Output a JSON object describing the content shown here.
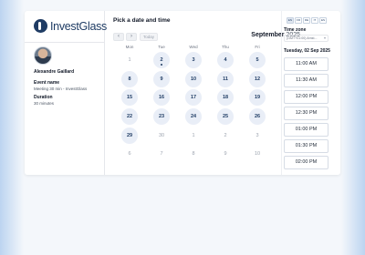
{
  "brand": {
    "name": "InvestGlass"
  },
  "host": {
    "name": "Alexandre Gaillard",
    "event_label": "Event name",
    "event_value": "Meeting 30 min - InvestGlass",
    "duration_label": "Duration",
    "duration_value": "30 minutes"
  },
  "calendar": {
    "title": "Pick a date and time",
    "prev_label": "‹",
    "next_label": "›",
    "today_label": "Today",
    "month": "September",
    "year": "2025",
    "weekdays": [
      "Mon",
      "Tue",
      "Wed",
      "Thu",
      "Fri"
    ],
    "weeks": [
      [
        {
          "d": "1",
          "a": false
        },
        {
          "d": "2",
          "a": true,
          "t": true
        },
        {
          "d": "3",
          "a": true
        },
        {
          "d": "4",
          "a": true
        },
        {
          "d": "5",
          "a": true
        }
      ],
      [
        {
          "d": "8",
          "a": true
        },
        {
          "d": "9",
          "a": true
        },
        {
          "d": "10",
          "a": true
        },
        {
          "d": "11",
          "a": true
        },
        {
          "d": "12",
          "a": true
        }
      ],
      [
        {
          "d": "15",
          "a": true
        },
        {
          "d": "16",
          "a": true
        },
        {
          "d": "17",
          "a": true
        },
        {
          "d": "18",
          "a": true
        },
        {
          "d": "19",
          "a": true
        }
      ],
      [
        {
          "d": "22",
          "a": true
        },
        {
          "d": "23",
          "a": true
        },
        {
          "d": "24",
          "a": true
        },
        {
          "d": "25",
          "a": true
        },
        {
          "d": "26",
          "a": true
        }
      ],
      [
        {
          "d": "29",
          "a": true
        },
        {
          "d": "30",
          "a": false
        },
        {
          "d": "1",
          "a": false
        },
        {
          "d": "2",
          "a": false
        },
        {
          "d": "3",
          "a": false
        }
      ],
      [
        {
          "d": "6",
          "a": false
        },
        {
          "d": "7",
          "a": false
        },
        {
          "d": "8",
          "a": false
        },
        {
          "d": "9",
          "a": false
        },
        {
          "d": "10",
          "a": false
        }
      ]
    ]
  },
  "sidebar": {
    "languages": [
      "EN",
      "FR",
      "DE",
      "IT",
      "ES"
    ],
    "timezone_label": "Time zone",
    "timezone_value": "(GMT+01:00) Amst...",
    "selected_date": "Tuesday, 02 Sep 2025",
    "slots": [
      "11:00 AM",
      "11:30 AM",
      "12:00 PM",
      "12:30 PM",
      "01:00 PM",
      "01:30 PM",
      "02:00 PM"
    ]
  }
}
